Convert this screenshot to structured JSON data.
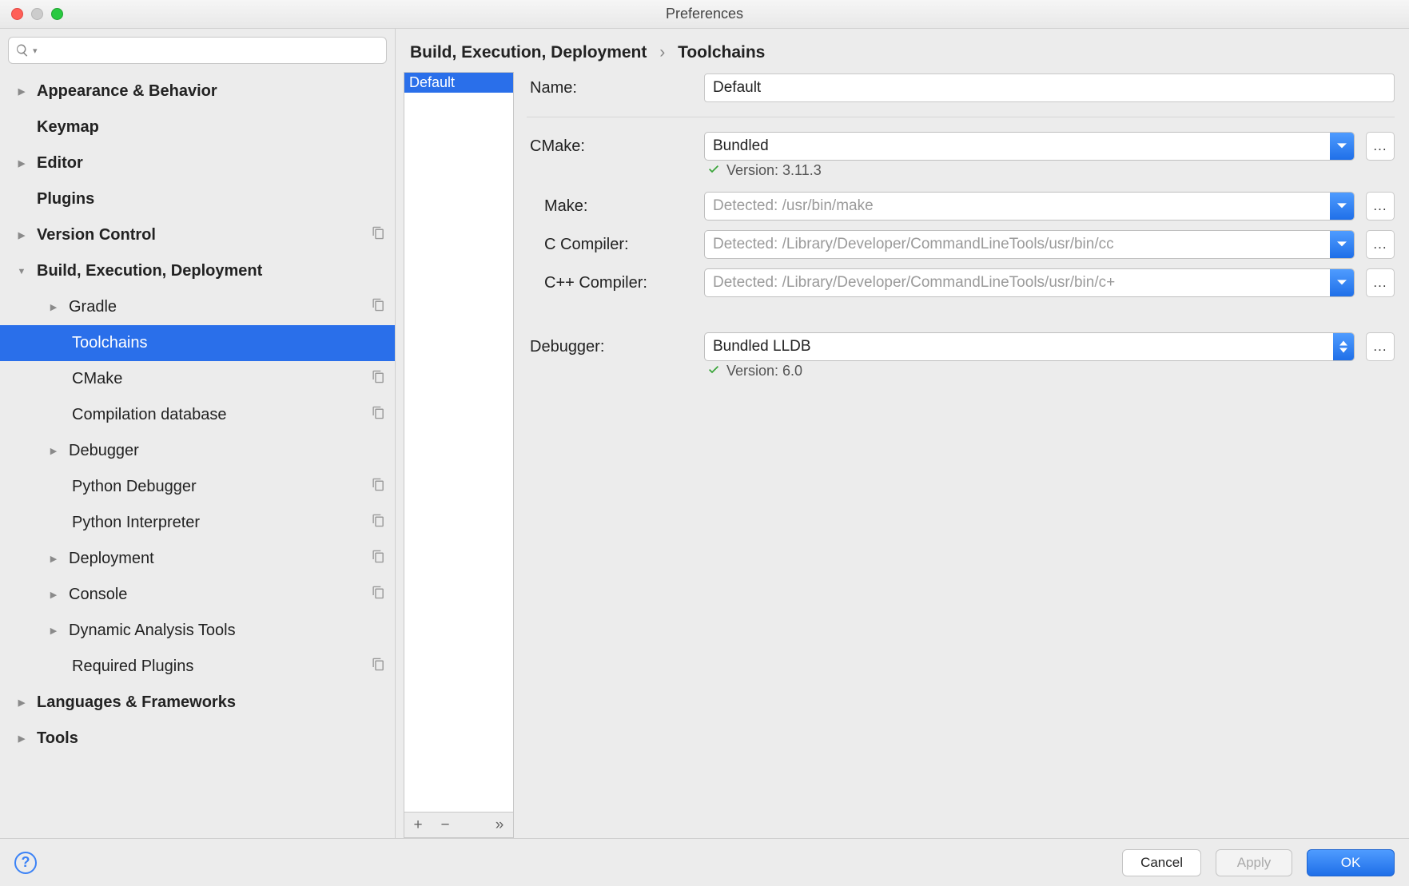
{
  "window": {
    "title": "Preferences"
  },
  "breadcrumb": {
    "parent": "Build, Execution, Deployment",
    "current": "Toolchains"
  },
  "sidebar": {
    "items": [
      {
        "label": "Appearance & Behavior",
        "bold": true,
        "expandable": true,
        "expanded": false
      },
      {
        "label": "Keymap",
        "bold": true
      },
      {
        "label": "Editor",
        "bold": true,
        "expandable": true,
        "expanded": false
      },
      {
        "label": "Plugins",
        "bold": true
      },
      {
        "label": "Version Control",
        "bold": true,
        "expandable": true,
        "expanded": false,
        "copyable": true
      },
      {
        "label": "Build, Execution, Deployment",
        "bold": true,
        "expandable": true,
        "expanded": true
      },
      {
        "label": "Gradle",
        "child": true,
        "expandable": true,
        "expanded": false,
        "copyable": true
      },
      {
        "label": "Toolchains",
        "child": true,
        "selected": true,
        "indentExtra": true
      },
      {
        "label": "CMake",
        "child": true,
        "copyable": true,
        "indentExtra": true
      },
      {
        "label": "Compilation database",
        "child": true,
        "copyable": true,
        "indentExtra": true
      },
      {
        "label": "Debugger",
        "child": true,
        "expandable": true,
        "expanded": false
      },
      {
        "label": "Python Debugger",
        "child": true,
        "copyable": true,
        "indentExtra": true
      },
      {
        "label": "Python Interpreter",
        "child": true,
        "copyable": true,
        "indentExtra": true
      },
      {
        "label": "Deployment",
        "child": true,
        "expandable": true,
        "expanded": false,
        "copyable": true
      },
      {
        "label": "Console",
        "child": true,
        "expandable": true,
        "expanded": false,
        "copyable": true
      },
      {
        "label": "Dynamic Analysis Tools",
        "child": true,
        "expandable": true,
        "expanded": false
      },
      {
        "label": "Required Plugins",
        "child": true,
        "copyable": true,
        "indentExtra": true
      },
      {
        "label": "Languages & Frameworks",
        "bold": true,
        "expandable": true,
        "expanded": false
      },
      {
        "label": "Tools",
        "bold": true,
        "expandable": true,
        "expanded": false
      }
    ]
  },
  "list": {
    "items": [
      {
        "label": "Default",
        "selected": true
      }
    ],
    "toolbar": {
      "add": "+",
      "remove": "−",
      "more": "»"
    }
  },
  "form": {
    "name_label": "Name:",
    "name_value": "Default",
    "cmake_label": "CMake:",
    "cmake_value": "Bundled",
    "cmake_status": "Version: 3.11.3",
    "make_label": "Make:",
    "make_placeholder": "Detected: /usr/bin/make",
    "cc_label": "C Compiler:",
    "cc_placeholder": "Detected: /Library/Developer/CommandLineTools/usr/bin/cc",
    "cxx_label": "C++ Compiler:",
    "cxx_placeholder": "Detected: /Library/Developer/CommandLineTools/usr/bin/c+",
    "debugger_label": "Debugger:",
    "debugger_value": "Bundled LLDB",
    "debugger_status": "Version: 6.0",
    "browse": "..."
  },
  "footer": {
    "cancel": "Cancel",
    "apply": "Apply",
    "ok": "OK"
  }
}
